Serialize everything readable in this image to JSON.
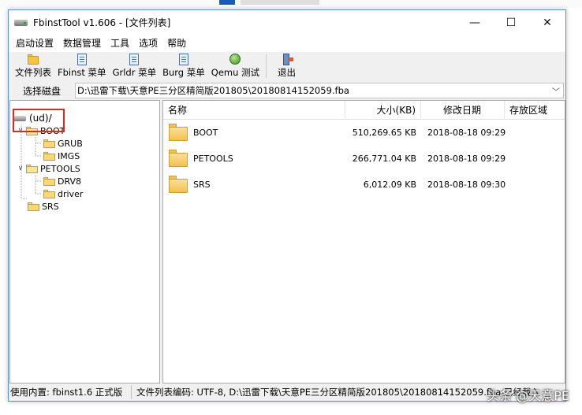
{
  "window": {
    "title": "FbinstTool v1.606 - [文件列表]",
    "controls": {
      "minimize": "—",
      "maximize": "☐",
      "close": "✕"
    }
  },
  "menu": {
    "items": [
      "启动设置",
      "数据管理",
      "工具",
      "选项",
      "帮助"
    ]
  },
  "toolbar": {
    "buttons": [
      {
        "label": "文件列表",
        "icon": "folder-icon"
      },
      {
        "label": "Fbinst 菜单",
        "icon": "document-icon"
      },
      {
        "label": "Grldr 菜单",
        "icon": "document-icon"
      },
      {
        "label": "Burg 菜单",
        "icon": "document-icon"
      },
      {
        "label": "Qemu 测试",
        "icon": "qemu-icon"
      },
      {
        "label": "退出",
        "icon": "exit-icon"
      }
    ]
  },
  "pathbar": {
    "label": "选择磁盘",
    "value": "D:\\迅雷下载\\天意PE三分区精简版201805\\20180814152059.fba"
  },
  "tree": {
    "root": "(ud)/",
    "nodes": [
      "BOOT",
      "GRUB",
      "IMGS",
      "PETOOLS",
      "DRV8",
      "driver",
      "SRS"
    ]
  },
  "list": {
    "columns": [
      "名称",
      "大小(KB)",
      "修改日期",
      "存放区域"
    ],
    "rows": [
      {
        "name": "BOOT",
        "size": "510,269.65 KB",
        "date": "2018-08-18 09:29",
        "area": ""
      },
      {
        "name": "PETOOLS",
        "size": "266,771.04 KB",
        "date": "2018-08-18 09:29",
        "area": ""
      },
      {
        "name": "SRS",
        "size": "6,012.09 KB",
        "date": "2018-08-18 09:30",
        "area": ""
      }
    ]
  },
  "status": {
    "left": "使用内置: fbinst1.6 正式版",
    "right": "文件列表编码: UTF-8, D:\\迅雷下载\\天意PE三分区精简版201805\\20180814152059.fba 已经载入"
  },
  "watermark": "头条 @天意PE",
  "colors": {
    "highlight": "#e8261f",
    "folder": "#f2c14e",
    "window_border": "#5d8fd6"
  }
}
